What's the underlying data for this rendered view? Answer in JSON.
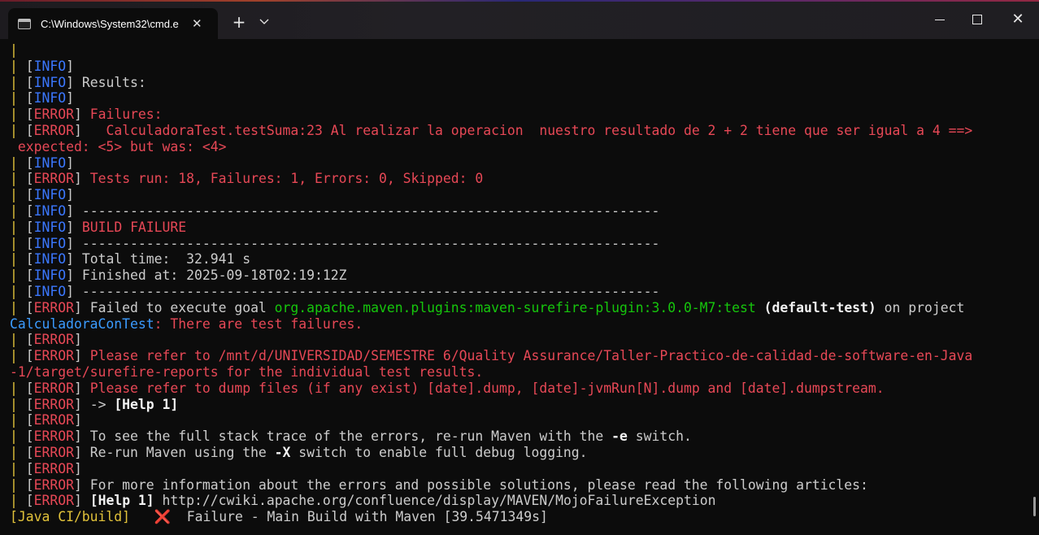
{
  "window": {
    "tab_title": "C:\\Windows\\System32\\cmd.e",
    "tab_close": "✕",
    "new_tab": "+",
    "dropdown": "⌄",
    "close_glyph": "✕"
  },
  "terminal": {
    "bar": "|",
    "lines": [
      {
        "parts": [
          {
            "t": "|",
            "c": "y"
          }
        ]
      },
      {
        "parts": [
          {
            "t": "| ",
            "c": "y"
          },
          {
            "t": "[",
            "c": "w"
          },
          {
            "t": "INFO",
            "c": "b"
          },
          {
            "t": "]",
            "c": "w"
          }
        ]
      },
      {
        "parts": [
          {
            "t": "| ",
            "c": "y"
          },
          {
            "t": "[",
            "c": "w"
          },
          {
            "t": "INFO",
            "c": "b"
          },
          {
            "t": "] Results:",
            "c": "w"
          }
        ]
      },
      {
        "parts": [
          {
            "t": "| ",
            "c": "y"
          },
          {
            "t": "[",
            "c": "w"
          },
          {
            "t": "INFO",
            "c": "b"
          },
          {
            "t": "]",
            "c": "w"
          }
        ]
      },
      {
        "parts": [
          {
            "t": "| ",
            "c": "y"
          },
          {
            "t": "[",
            "c": "w"
          },
          {
            "t": "ERROR",
            "c": "r"
          },
          {
            "t": "] ",
            "c": "w"
          },
          {
            "t": "Failures:",
            "c": "r"
          }
        ]
      },
      {
        "parts": [
          {
            "t": "| ",
            "c": "y"
          },
          {
            "t": "[",
            "c": "w"
          },
          {
            "t": "ERROR",
            "c": "r"
          },
          {
            "t": "]   ",
            "c": "w"
          },
          {
            "t": "CalculadoraTest.testSuma:23 Al realizar la operacion  nuestro resultado de 2 + 2 tiene que ser igual a 4 ==>",
            "c": "r"
          }
        ]
      },
      {
        "parts": [
          {
            "t": " expected: <5> but was: <4>",
            "c": "r"
          }
        ]
      },
      {
        "parts": [
          {
            "t": "| ",
            "c": "y"
          },
          {
            "t": "[",
            "c": "w"
          },
          {
            "t": "INFO",
            "c": "b"
          },
          {
            "t": "]",
            "c": "w"
          }
        ]
      },
      {
        "parts": [
          {
            "t": "| ",
            "c": "y"
          },
          {
            "t": "[",
            "c": "w"
          },
          {
            "t": "ERROR",
            "c": "r"
          },
          {
            "t": "] ",
            "c": "w"
          },
          {
            "t": "Tests run: 18, Failures: 1, Errors: 0, Skipped: 0",
            "c": "r"
          }
        ]
      },
      {
        "parts": [
          {
            "t": "| ",
            "c": "y"
          },
          {
            "t": "[",
            "c": "w"
          },
          {
            "t": "INFO",
            "c": "b"
          },
          {
            "t": "]",
            "c": "w"
          }
        ]
      },
      {
        "parts": [
          {
            "t": "| ",
            "c": "y"
          },
          {
            "t": "[",
            "c": "w"
          },
          {
            "t": "INFO",
            "c": "b"
          },
          {
            "t": "] ------------------------------------------------------------------------",
            "c": "w"
          }
        ]
      },
      {
        "parts": [
          {
            "t": "| ",
            "c": "y"
          },
          {
            "t": "[",
            "c": "w"
          },
          {
            "t": "INFO",
            "c": "b"
          },
          {
            "t": "] ",
            "c": "w"
          },
          {
            "t": "BUILD FAILURE",
            "c": "r"
          }
        ]
      },
      {
        "parts": [
          {
            "t": "| ",
            "c": "y"
          },
          {
            "t": "[",
            "c": "w"
          },
          {
            "t": "INFO",
            "c": "b"
          },
          {
            "t": "] ------------------------------------------------------------------------",
            "c": "w"
          }
        ]
      },
      {
        "parts": [
          {
            "t": "| ",
            "c": "y"
          },
          {
            "t": "[",
            "c": "w"
          },
          {
            "t": "INFO",
            "c": "b"
          },
          {
            "t": "] Total time:  32.941 s",
            "c": "w"
          }
        ]
      },
      {
        "parts": [
          {
            "t": "| ",
            "c": "y"
          },
          {
            "t": "[",
            "c": "w"
          },
          {
            "t": "INFO",
            "c": "b"
          },
          {
            "t": "] Finished at: 2025-09-18T02:19:12Z",
            "c": "w"
          }
        ]
      },
      {
        "parts": [
          {
            "t": "| ",
            "c": "y"
          },
          {
            "t": "[",
            "c": "w"
          },
          {
            "t": "INFO",
            "c": "b"
          },
          {
            "t": "] ------------------------------------------------------------------------",
            "c": "w"
          }
        ]
      },
      {
        "parts": [
          {
            "t": "| ",
            "c": "y"
          },
          {
            "t": "[",
            "c": "w"
          },
          {
            "t": "ERROR",
            "c": "r"
          },
          {
            "t": "] Failed to execute goal ",
            "c": "w"
          },
          {
            "t": "org.apache.maven.plugins:maven-surefire-plugin:3.0.0-M7:test",
            "c": "g"
          },
          {
            "t": " (default-test)",
            "c": "bw"
          },
          {
            "t": " on project",
            "c": "w"
          }
        ]
      },
      {
        "parts": [
          {
            "t": "CalculadoraConTest",
            "c": "c"
          },
          {
            "t": ": There are test failures.",
            "c": "r"
          }
        ],
        "x": 0
      },
      {
        "parts": [
          {
            "t": "| ",
            "c": "y"
          },
          {
            "t": "[",
            "c": "w"
          },
          {
            "t": "ERROR",
            "c": "r"
          },
          {
            "t": "]",
            "c": "w"
          }
        ]
      },
      {
        "parts": [
          {
            "t": "| ",
            "c": "y"
          },
          {
            "t": "[",
            "c": "w"
          },
          {
            "t": "ERROR",
            "c": "r"
          },
          {
            "t": "] ",
            "c": "w"
          },
          {
            "t": "Please refer to /mnt/d/UNIVERSIDAD/SEMESTRE 6/Quality Assurance/Taller-Practico-de-calidad-de-software-en-Java",
            "c": "r"
          }
        ]
      },
      {
        "parts": [
          {
            "t": "-1/target/surefire-reports for the individual test results.",
            "c": "r"
          }
        ],
        "x": 0
      },
      {
        "parts": [
          {
            "t": "| ",
            "c": "y"
          },
          {
            "t": "[",
            "c": "w"
          },
          {
            "t": "ERROR",
            "c": "r"
          },
          {
            "t": "] ",
            "c": "w"
          },
          {
            "t": "Please refer to dump files (if any exist) [date].dump, [date]-jvmRun[N].dump and [date].dumpstream.",
            "c": "r"
          }
        ]
      },
      {
        "parts": [
          {
            "t": "| ",
            "c": "y"
          },
          {
            "t": "[",
            "c": "w"
          },
          {
            "t": "ERROR",
            "c": "r"
          },
          {
            "t": "] -> ",
            "c": "w"
          },
          {
            "t": "[Help 1]",
            "c": "bw"
          }
        ]
      },
      {
        "parts": [
          {
            "t": "| ",
            "c": "y"
          },
          {
            "t": "[",
            "c": "w"
          },
          {
            "t": "ERROR",
            "c": "r"
          },
          {
            "t": "]",
            "c": "w"
          }
        ]
      },
      {
        "parts": [
          {
            "t": "| ",
            "c": "y"
          },
          {
            "t": "[",
            "c": "w"
          },
          {
            "t": "ERROR",
            "c": "r"
          },
          {
            "t": "] To see the full stack trace of the errors, re-run Maven with the ",
            "c": "w"
          },
          {
            "t": "-e",
            "c": "bw"
          },
          {
            "t": " switch.",
            "c": "w"
          }
        ]
      },
      {
        "parts": [
          {
            "t": "| ",
            "c": "y"
          },
          {
            "t": "[",
            "c": "w"
          },
          {
            "t": "ERROR",
            "c": "r"
          },
          {
            "t": "] Re-run Maven using the ",
            "c": "w"
          },
          {
            "t": "-X",
            "c": "bw"
          },
          {
            "t": " switch to enable full debug logging.",
            "c": "w"
          }
        ]
      },
      {
        "parts": [
          {
            "t": "| ",
            "c": "y"
          },
          {
            "t": "[",
            "c": "w"
          },
          {
            "t": "ERROR",
            "c": "r"
          },
          {
            "t": "]",
            "c": "w"
          }
        ]
      },
      {
        "parts": [
          {
            "t": "| ",
            "c": "y"
          },
          {
            "t": "[",
            "c": "w"
          },
          {
            "t": "ERROR",
            "c": "r"
          },
          {
            "t": "] For more information about the errors and possible solutions, please read the following articles:",
            "c": "w"
          }
        ]
      },
      {
        "parts": [
          {
            "t": "| ",
            "c": "y"
          },
          {
            "t": "[",
            "c": "w"
          },
          {
            "t": "ERROR",
            "c": "r"
          },
          {
            "t": "] ",
            "c": "w"
          },
          {
            "t": "[Help 1]",
            "c": "bw"
          },
          {
            "t": " http://cwiki.apache.org/confluence/display/MAVEN/MojoFailureException",
            "c": "w"
          }
        ]
      },
      {
        "parts": [
          {
            "t": "[Java CI/build]",
            "c": "y"
          },
          {
            "t": "   ",
            "c": "w"
          },
          {
            "t": "❌",
            "c": "xicon"
          },
          {
            "t": "  Failure - Main Build with Maven [39.5471349s]",
            "c": "w"
          }
        ],
        "x": 0
      }
    ]
  },
  "colors": {
    "yellow": "#e1c23a",
    "blue": "#3b78ff",
    "red": "#e74856",
    "green": "#16c60c",
    "text": "#cccccc",
    "background": "#0c0c0c"
  }
}
